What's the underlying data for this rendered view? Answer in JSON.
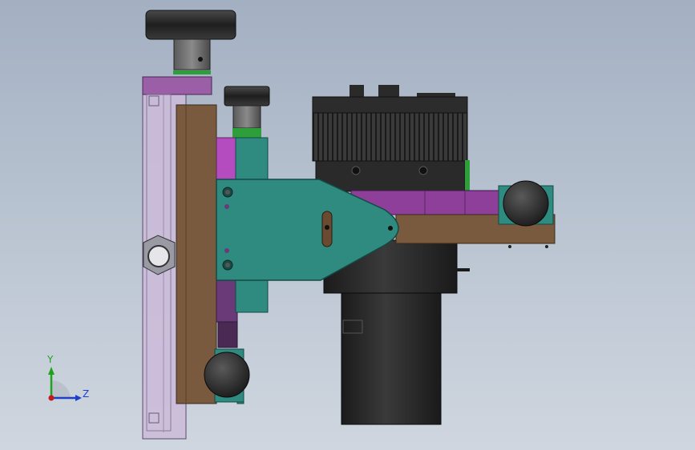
{
  "viewport": {
    "background_top": "#a3b0c2",
    "background_bottom": "#cfd6df"
  },
  "triad": {
    "y_label": "Y",
    "z_label": "Z",
    "y_color": "#1fa31f",
    "z_color": "#1f3fc9",
    "origin_color": "#c41a1a"
  },
  "model": {
    "parts": [
      "left-slide-rail",
      "top-adjust-knob",
      "upper-small-knob",
      "vertical-brown-plate",
      "magenta-carriage",
      "teal-mount-block",
      "teal-bracket-plate",
      "brown-horizontal-arm",
      "camera-body",
      "camera-lens",
      "right-clamp-knob",
      "bottom-clamp-knob",
      "hex-nut"
    ],
    "colors": {
      "rail": "#c8b8d8",
      "brown": "#7a5a3e",
      "teal": "#2f8a80",
      "magenta": "#a04aa8",
      "dark": "#2a2a2a",
      "green": "#2e9e3a"
    }
  }
}
